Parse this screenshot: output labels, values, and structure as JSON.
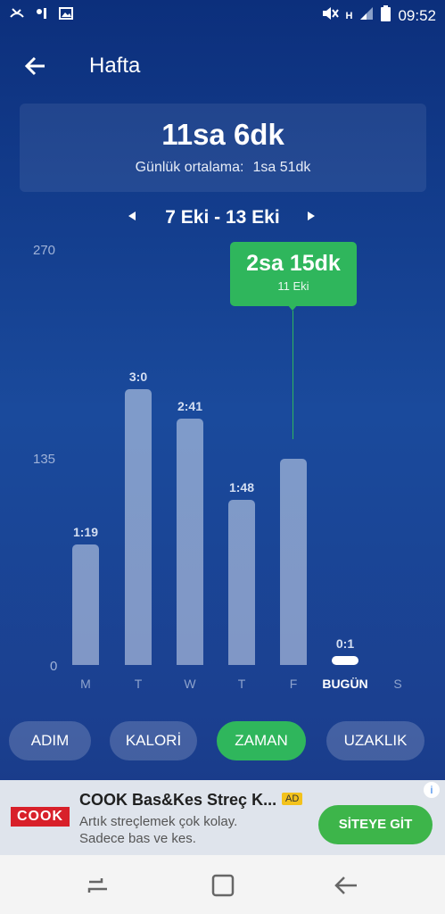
{
  "status": {
    "left_icons": [
      "missed-call-icon",
      "voicemail-icon",
      "image-icon"
    ],
    "right_icons": [
      "mute-icon",
      "h-network-icon",
      "signal-icon",
      "battery-icon"
    ],
    "time": "09:52"
  },
  "header": {
    "title": "Hafta"
  },
  "summary": {
    "total": "11sa 6dk",
    "avg_label": "Günlük ortalama:",
    "avg_value": "1sa 51dk"
  },
  "range": {
    "label": "7 Eki - 13 Eki"
  },
  "chart_data": {
    "type": "bar",
    "categories": [
      "M",
      "T",
      "W",
      "T",
      "F",
      "BUGÜN",
      "S"
    ],
    "values_minutes": [
      79,
      180,
      161,
      108,
      135,
      1,
      0
    ],
    "bar_labels": [
      "1:19",
      "3:0",
      "2:41",
      "1:48",
      "",
      "0:1",
      ""
    ],
    "yticks": [
      "270",
      "135",
      "0"
    ],
    "ylim": [
      0,
      270
    ],
    "highlight": {
      "index": 4,
      "value": "2sa 15dk",
      "date": "11 Eki"
    },
    "colors": {
      "bar": "#d4def0",
      "highlight": "#2fb65c"
    }
  },
  "tabs": [
    {
      "label": "ADIM",
      "active": false
    },
    {
      "label": "KALORİ",
      "active": false
    },
    {
      "label": "ZAMAN",
      "active": true
    },
    {
      "label": "UZAKLIK",
      "active": false
    }
  ],
  "ad": {
    "logo_text": "COOK",
    "title": "COOK Bas&Kes Streç K...",
    "badge": "AD",
    "line1": "Artık streçlemek çok kolay.",
    "line2": "Sadece bas ve kes.",
    "cta": "SİTEYE GİT",
    "info": "i"
  },
  "colors": {
    "accent": "#2fb65c",
    "bg_top": "#0c2f7c",
    "bg_bottom": "#16357f"
  }
}
